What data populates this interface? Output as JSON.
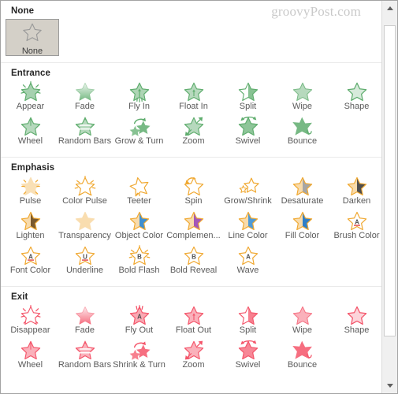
{
  "watermark": "groovyPost.com",
  "scrollbar": {
    "up_arrow": "scroll-up-arrow",
    "down_arrow": "scroll-down-arrow"
  },
  "sections": [
    {
      "id": "none",
      "title": "None",
      "type": "tile",
      "color": "#9a9a9a",
      "items": [
        {
          "label": "None",
          "icon": "star-outline"
        }
      ]
    },
    {
      "id": "entrance",
      "title": "Entrance",
      "type": "grid",
      "color": "#5fad6e",
      "items": [
        {
          "label": "Appear",
          "icon": "star-burst"
        },
        {
          "label": "Fade",
          "icon": "star-fade"
        },
        {
          "label": "Fly In",
          "icon": "star-fly-in"
        },
        {
          "label": "Float In",
          "icon": "star-float-in"
        },
        {
          "label": "Split",
          "icon": "star-split"
        },
        {
          "label": "Wipe",
          "icon": "star-wipe"
        },
        {
          "label": "Shape",
          "icon": "star-shape"
        },
        {
          "label": "Wheel",
          "icon": "star-wheel"
        },
        {
          "label": "Random Bars",
          "icon": "star-random-bars"
        },
        {
          "label": "Grow & Turn",
          "icon": "star-grow-turn"
        },
        {
          "label": "Zoom",
          "icon": "star-zoom"
        },
        {
          "label": "Swivel",
          "icon": "star-swivel"
        },
        {
          "label": "Bounce",
          "icon": "star-bounce"
        }
      ]
    },
    {
      "id": "emphasis",
      "title": "Emphasis",
      "type": "grid",
      "color": "#f0a830",
      "items": [
        {
          "label": "Pulse",
          "icon": "star-pulse"
        },
        {
          "label": "Color Pulse",
          "icon": "star-color-pulse"
        },
        {
          "label": "Teeter",
          "icon": "star-teeter"
        },
        {
          "label": "Spin",
          "icon": "star-spin"
        },
        {
          "label": "Grow/Shrink",
          "icon": "star-grow-shrink"
        },
        {
          "label": "Desaturate",
          "icon": "star-half-gray",
          "half": "#a6a6a6"
        },
        {
          "label": "Darken",
          "icon": "star-half-dark",
          "half": "#4f4f4f"
        },
        {
          "label": "Lighten",
          "icon": "star-half-brown",
          "half": "#7a5a2e"
        },
        {
          "label": "Transparency",
          "icon": "star-transparency"
        },
        {
          "label": "Object Color",
          "icon": "star-half-blue",
          "half": "#3f8fd0"
        },
        {
          "label": "Complemen...",
          "icon": "star-half-purple",
          "half": "#a458b8"
        },
        {
          "label": "Line Color",
          "icon": "star-half-blue2",
          "half": "#4f9ad6"
        },
        {
          "label": "Fill Color",
          "icon": "star-half-blue3",
          "half": "#2f7fc8"
        },
        {
          "label": "Brush Color",
          "icon": "star-letter-a-underline"
        },
        {
          "label": "Font Color",
          "icon": "star-letter-a-underline"
        },
        {
          "label": "Underline",
          "icon": "star-letter-u-underline"
        },
        {
          "label": "Bold Flash",
          "icon": "star-letter-b-burst"
        },
        {
          "label": "Bold Reveal",
          "icon": "star-letter-b"
        },
        {
          "label": "Wave",
          "icon": "star-letter-a"
        }
      ]
    },
    {
      "id": "exit",
      "title": "Exit",
      "type": "grid",
      "color": "#f4556a",
      "items": [
        {
          "label": "Disappear",
          "icon": "star-burst-hollow"
        },
        {
          "label": "Fade",
          "icon": "star-fade"
        },
        {
          "label": "Fly Out",
          "icon": "star-fly-out"
        },
        {
          "label": "Float Out",
          "icon": "star-float-out"
        },
        {
          "label": "Split",
          "icon": "star-split"
        },
        {
          "label": "Wipe",
          "icon": "star-wipe"
        },
        {
          "label": "Shape",
          "icon": "star-shape"
        },
        {
          "label": "Wheel",
          "icon": "star-wheel"
        },
        {
          "label": "Random Bars",
          "icon": "star-random-bars"
        },
        {
          "label": "Shrink & Turn",
          "icon": "star-grow-turn"
        },
        {
          "label": "Zoom",
          "icon": "star-zoom"
        },
        {
          "label": "Swivel",
          "icon": "star-swivel"
        },
        {
          "label": "Bounce",
          "icon": "star-bounce"
        }
      ]
    }
  ]
}
